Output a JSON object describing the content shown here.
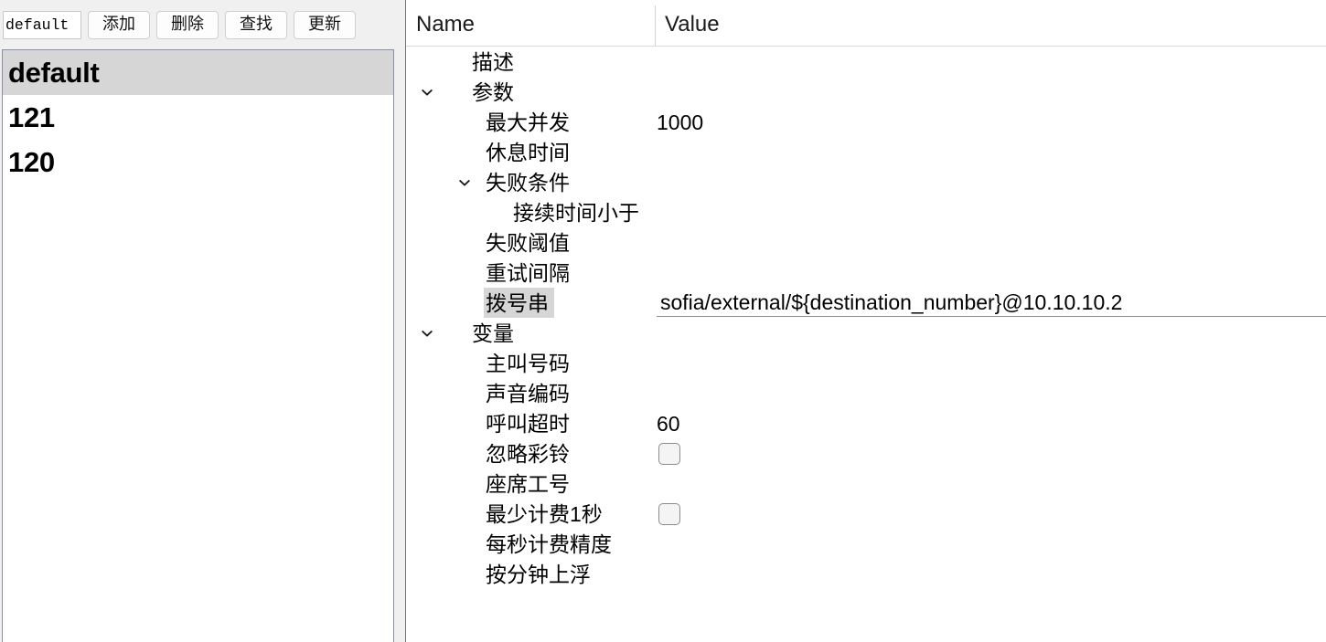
{
  "toolbar": {
    "profile_input_value": "default",
    "profile_input_placeholder": "default",
    "buttons": [
      {
        "label": "添加",
        "name": "add-button"
      },
      {
        "label": "删除",
        "name": "delete-button"
      },
      {
        "label": "查找",
        "name": "find-button"
      },
      {
        "label": "更新",
        "name": "update-button"
      }
    ]
  },
  "gateway_list": {
    "items": [
      {
        "label": "default",
        "selected": true
      },
      {
        "label": "121",
        "selected": false
      },
      {
        "label": "120",
        "selected": false
      }
    ]
  },
  "tree": {
    "columns": {
      "name": "Name",
      "value": "Value"
    },
    "rows": [
      {
        "name": "描述",
        "value": "",
        "indent": 1,
        "expander": "none"
      },
      {
        "name": "参数",
        "value": "",
        "indent": 1,
        "expander": "expanded"
      },
      {
        "name": "最大并发",
        "value": "1000",
        "indent": 2,
        "expander": "none"
      },
      {
        "name": "休息时间",
        "value": "",
        "indent": 2,
        "expander": "none"
      },
      {
        "name": "失败条件",
        "value": "",
        "indent": 2,
        "expander": "expanded"
      },
      {
        "name": "接续时间小于",
        "value": "",
        "indent": 3,
        "expander": "none"
      },
      {
        "name": "失败阈值",
        "value": "",
        "indent": 2,
        "expander": "none"
      },
      {
        "name": "重试间隔",
        "value": "",
        "indent": 2,
        "expander": "none"
      },
      {
        "name": "拨号串",
        "value": "sofia/external/${destination_number}@10.10.10.2",
        "indent": 2,
        "expander": "none",
        "selected": true,
        "editing": true
      },
      {
        "name": "变量",
        "value": "",
        "indent": 1,
        "expander": "expanded"
      },
      {
        "name": "主叫号码",
        "value": "",
        "indent": 2,
        "expander": "none"
      },
      {
        "name": "声音编码",
        "value": "",
        "indent": 2,
        "expander": "none"
      },
      {
        "name": "呼叫超时",
        "value": "60",
        "indent": 2,
        "expander": "none"
      },
      {
        "name": "忽略彩铃",
        "value": "",
        "indent": 2,
        "expander": "none",
        "checkbox": false
      },
      {
        "name": "座席工号",
        "value": "",
        "indent": 2,
        "expander": "none"
      },
      {
        "name": "最少计费1秒",
        "value": "",
        "indent": 2,
        "expander": "none",
        "checkbox": false
      },
      {
        "name": "每秒计费精度",
        "value": "",
        "indent": 2,
        "expander": "none"
      },
      {
        "name": "按分钟上浮",
        "value": "",
        "indent": 2,
        "expander": "none"
      }
    ]
  },
  "colors": {
    "selection": "#d6d6d6",
    "panel_bg": "#f0f0f0",
    "border": "#8b909a",
    "header_rule": "#d9d9d9"
  }
}
